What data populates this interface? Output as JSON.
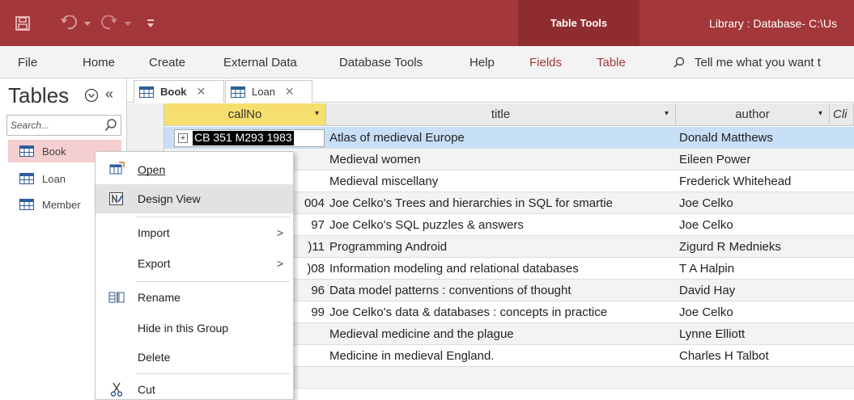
{
  "titlebar": {
    "context_tab_label": "Table Tools",
    "window_title": "Library : Database- C:\\Us"
  },
  "ribbon": {
    "tabs": [
      {
        "label": "File",
        "contextual": false
      },
      {
        "label": "Home",
        "contextual": false
      },
      {
        "label": "Create",
        "contextual": false
      },
      {
        "label": "External Data",
        "contextual": false
      },
      {
        "label": "Database Tools",
        "contextual": false
      },
      {
        "label": "Help",
        "contextual": false
      },
      {
        "label": "Fields",
        "contextual": true
      },
      {
        "label": "Table",
        "contextual": true
      }
    ],
    "tell_me": "Tell me what you want t"
  },
  "nav": {
    "title": "Tables",
    "search_placeholder": "Search...",
    "items": [
      {
        "label": "Book",
        "selected": true
      },
      {
        "label": "Loan",
        "selected": false
      },
      {
        "label": "Member",
        "selected": false
      }
    ]
  },
  "doc_tabs": [
    {
      "label": "Book",
      "active": true
    },
    {
      "label": "Loan",
      "active": false
    }
  ],
  "datasheet": {
    "columns": [
      "callNo",
      "title",
      "author",
      "Cli"
    ],
    "rows": [
      {
        "callNo": "CB 351 M293 1983",
        "title": "Atlas of medieval Europe",
        "author": "Donald Matthews"
      },
      {
        "callNo": "",
        "title": "Medieval women",
        "author": "Eileen Power"
      },
      {
        "callNo": "",
        "title": "Medieval miscellany",
        "author": "Frederick Whitehead"
      },
      {
        "callNo": "004",
        "title": "Joe Celko's Trees and hierarchies in SQL for smartie",
        "author": "Joe Celko"
      },
      {
        "callNo": "97",
        "title": "Joe Celko's SQL puzzles & answers",
        "author": "Joe Celko"
      },
      {
        "callNo": ")11",
        "title": "Programming Android",
        "author": "Zigurd R Mednieks"
      },
      {
        "callNo": ")08",
        "title": "Information modeling and relational databases",
        "author": "T A Halpin"
      },
      {
        "callNo": "96",
        "title": "Data model patterns : conventions of thought",
        "author": "David Hay"
      },
      {
        "callNo": "99",
        "title": "Joe Celko's data & databases : concepts in practice",
        "author": "Joe Celko"
      },
      {
        "callNo": "",
        "title": "Medieval medicine and the plague",
        "author": "Lynne Elliott"
      },
      {
        "callNo": "",
        "title": "Medicine in medieval England.",
        "author": "Charles H Talbot"
      }
    ]
  },
  "context_menu": {
    "items": [
      {
        "label": "Open"
      },
      {
        "label": "Design View"
      },
      {
        "label": "Import"
      },
      {
        "label": "Export"
      },
      {
        "label": "Rename"
      },
      {
        "label": "Hide in this Group"
      },
      {
        "label": "Delete"
      },
      {
        "label": "Cut"
      }
    ]
  },
  "colors": {
    "titlebar": "#a4373a",
    "context_tab_bg": "#8e2c2f",
    "callno_header": "#f7df6f",
    "selected_row": "#c7dff7",
    "nav_selected": "#f5cfcf"
  }
}
